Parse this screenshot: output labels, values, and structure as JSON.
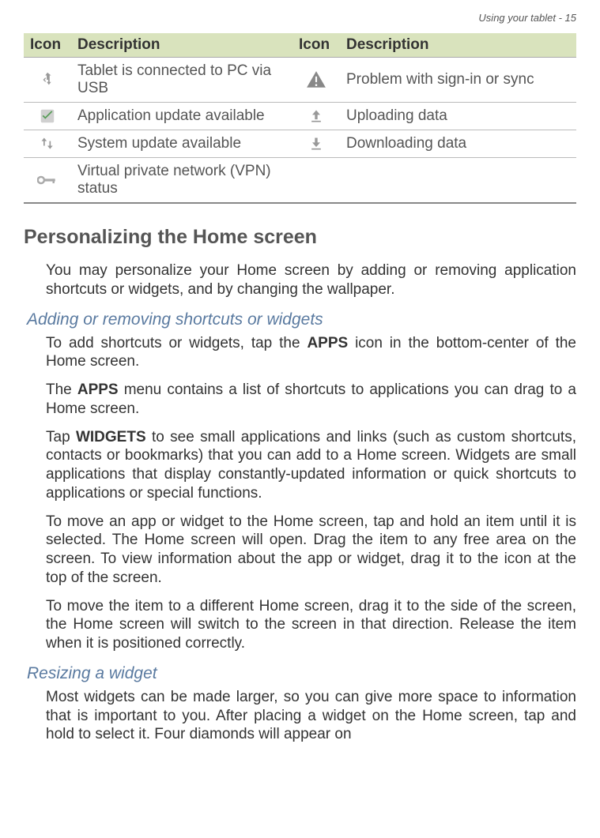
{
  "header": {
    "text": "Using your tablet - 15"
  },
  "table": {
    "headers": [
      "Icon",
      "Description",
      "Icon",
      "Description"
    ],
    "rows": [
      {
        "desc1": "Tablet is connected to PC via USB",
        "desc2": "Problem with sign-in or sync"
      },
      {
        "desc1": "Application update available",
        "desc2": "Uploading data"
      },
      {
        "desc1": "System update available",
        "desc2": "Downloading data"
      },
      {
        "desc1": "Virtual private network (VPN) status",
        "desc2": ""
      }
    ]
  },
  "section1": {
    "heading": "Personalizing the Home screen",
    "p1": "You may personalize your Home screen by adding or removing application shortcuts or widgets, and by changing the wallpaper."
  },
  "section2": {
    "heading": "Adding or removing shortcuts or widgets",
    "p1_a": "To add shortcuts or widgets, tap the ",
    "p1_b": "APPS",
    "p1_c": " icon in the bottom-center of the Home screen.",
    "p2_a": "The ",
    "p2_b": "APPS",
    "p2_c": " menu contains a list of shortcuts to applications you can drag to a Home screen.",
    "p3_a": "Tap ",
    "p3_b": "WIDGETS",
    "p3_c": " to see small applications and links (such as custom shortcuts, contacts or bookmarks) that you can add to a Home screen. Widgets are small applications that display constantly-updated information or quick shortcuts to applications or special functions.",
    "p4": "To move an app or widget to the Home screen, tap and hold an item until it is selected. The Home screen will open. Drag the item to any free area on the screen. To view information about the app or widget, drag it to the icon at the top of the screen.",
    "p5": "To move the item to a different Home screen, drag it to the side of the screen, the Home screen will switch to the screen in that direction. Release the item when it is positioned correctly."
  },
  "section3": {
    "heading": "Resizing a widget",
    "p1": "Most widgets can be made larger, so you can give more space to information that is important to you. After placing a widget on the Home screen, tap and hold to select it. Four diamonds will appear on"
  }
}
